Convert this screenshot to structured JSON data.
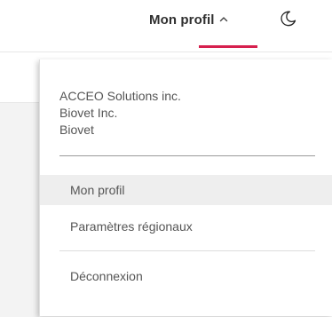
{
  "header": {
    "profile_menu_label": "Mon profil",
    "active_indicator_color": "#d6204e",
    "chevron_icon": "chevron-up-icon",
    "theme_icon": "moon-icon"
  },
  "dropdown": {
    "organizations": [
      "ACCEO Solutions inc.",
      "Biovet Inc.",
      "Biovet"
    ],
    "items": [
      {
        "label": "Mon profil",
        "active": true
      },
      {
        "label": "Paramètres régionaux",
        "active": false
      },
      {
        "label": "Déconnexion",
        "active": false
      }
    ]
  }
}
